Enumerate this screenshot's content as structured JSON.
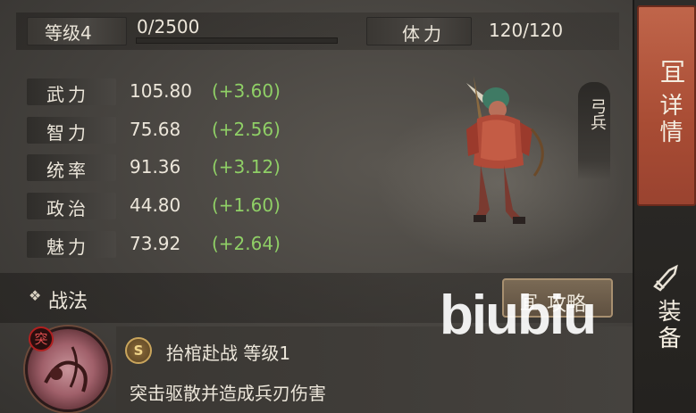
{
  "header": {
    "level_label": "等级4",
    "exp_text": "0/2500",
    "exp_fraction": 0.0,
    "stamina_label": "体力",
    "stamina_value": "120/120"
  },
  "stats": [
    {
      "label": "武力",
      "value": "105.80",
      "bonus": "(+3.60)"
    },
    {
      "label": "智力",
      "value": "75.68",
      "bonus": "(+2.56)"
    },
    {
      "label": "统率",
      "value": "91.36",
      "bonus": "(+3.12)"
    },
    {
      "label": "政治",
      "value": "44.80",
      "bonus": "(+1.60)"
    },
    {
      "label": "魅力",
      "value": "73.92",
      "bonus": "(+2.64)"
    }
  ],
  "unit_type": "弓兵",
  "sidebar": {
    "detail_icon": "冝",
    "detail_label": "详情",
    "equip_label": "装备",
    "equip_icon": "equipment-icon"
  },
  "skills": {
    "section_title": "战法",
    "section_icon": "❖",
    "strategy_icon": "冝",
    "strategy_label": "攻略",
    "mark": "突",
    "badge": "S",
    "name_level": "抬棺赴战  等级1",
    "description": "突击驱散并造成兵刃伤害"
  },
  "watermark": "biubiu",
  "colors": {
    "bonus": "#8fcf66",
    "active_tab": "#b0543a",
    "exp_bar": "#c7a248"
  }
}
